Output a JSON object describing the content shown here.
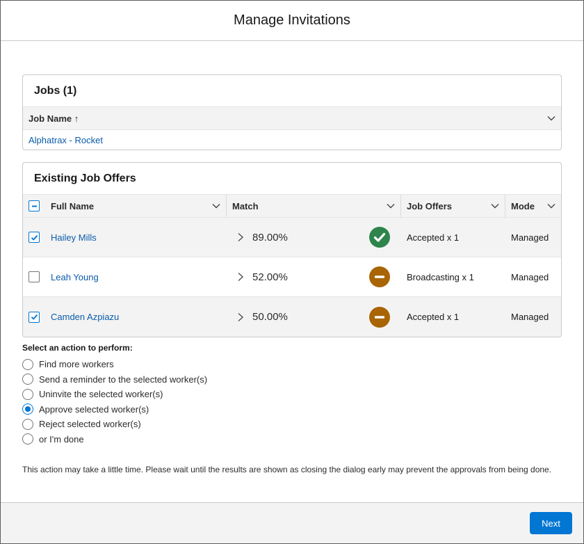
{
  "dialog": {
    "title": "Manage Invitations"
  },
  "jobs": {
    "title": "Jobs (1)",
    "column": "Job Name ↑",
    "rows": [
      {
        "name": "Alphatrax - Rocket"
      }
    ]
  },
  "offers": {
    "title": "Existing Job Offers",
    "columns": {
      "full_name": "Full Name",
      "match": "Match",
      "job_offers": "Job Offers",
      "mode": "Mode"
    },
    "rows": [
      {
        "name": "Hailey Mills",
        "checked": true,
        "match": "89.00%",
        "status": "check-circle-icon",
        "status_color": "#2e844a",
        "offers": "Accepted x 1",
        "mode": "Managed"
      },
      {
        "name": "Leah Young",
        "checked": false,
        "match": "52.00%",
        "status": "minus-circle-icon",
        "status_color": "#a96404",
        "offers": "Broadcasting x 1",
        "mode": "Managed"
      },
      {
        "name": "Camden Azpiazu",
        "checked": true,
        "match": "50.00%",
        "status": "minus-circle-icon",
        "status_color": "#a96404",
        "offers": "Accepted x 1",
        "mode": "Managed"
      }
    ]
  },
  "actions": {
    "label": "Select an action to perform:",
    "options": [
      {
        "label": "Find more workers",
        "selected": false
      },
      {
        "label": "Send a reminder to the selected worker(s)",
        "selected": false
      },
      {
        "label": "Uninvite the selected worker(s)",
        "selected": false
      },
      {
        "label": "Approve selected worker(s)",
        "selected": true
      },
      {
        "label": "Reject selected worker(s)",
        "selected": false
      },
      {
        "label": "or I'm done",
        "selected": false
      }
    ]
  },
  "note": "This action may take a little time. Please wait until the results are shown as closing the dialog early may prevent the approvals from being done.",
  "footer": {
    "next_label": "Next"
  },
  "colors": {
    "accent": "#0176d3",
    "link": "#0b5cab",
    "success": "#2e844a",
    "warning": "#a96404"
  }
}
